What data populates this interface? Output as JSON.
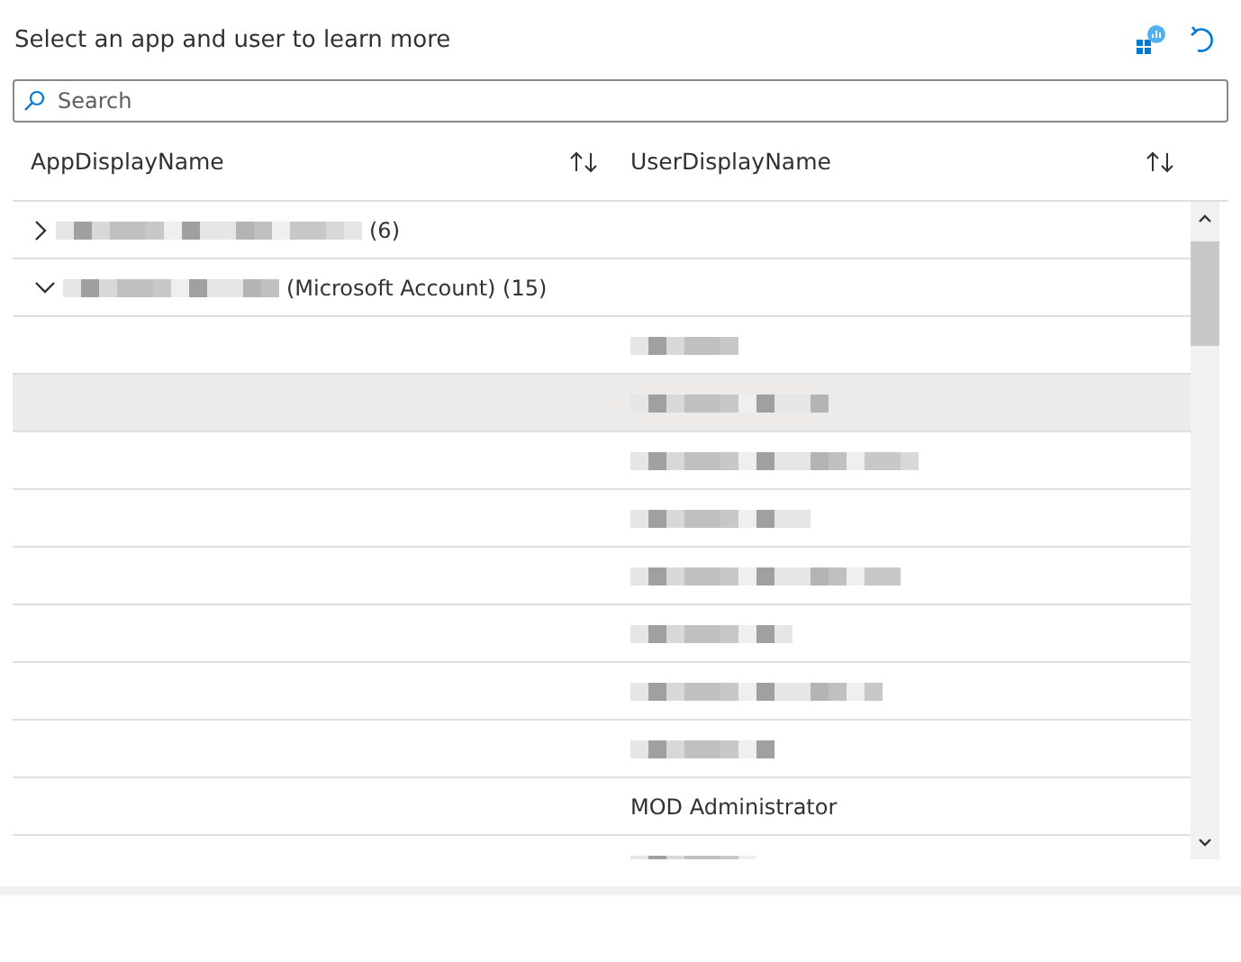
{
  "title": "Select an app and user to learn more",
  "search": {
    "placeholder": "Search"
  },
  "columns": [
    {
      "label": "AppDisplayName"
    },
    {
      "label": "UserDisplayName"
    }
  ],
  "groups": [
    {
      "expanded": false,
      "caption": "(6)"
    },
    {
      "expanded": true,
      "caption": "(Microsoft Account) (15)",
      "rows": [
        {
          "kind": "redacted",
          "selected": false
        },
        {
          "kind": "redacted",
          "selected": true
        },
        {
          "kind": "redacted",
          "selected": false
        },
        {
          "kind": "redacted",
          "selected": false
        },
        {
          "kind": "redacted",
          "selected": false
        },
        {
          "kind": "redacted",
          "selected": false
        },
        {
          "kind": "redacted",
          "selected": false
        },
        {
          "kind": "redacted",
          "selected": false
        },
        {
          "kind": "text",
          "user": "MOD Administrator",
          "selected": false
        },
        {
          "kind": "redacted",
          "selected": false
        }
      ]
    }
  ]
}
